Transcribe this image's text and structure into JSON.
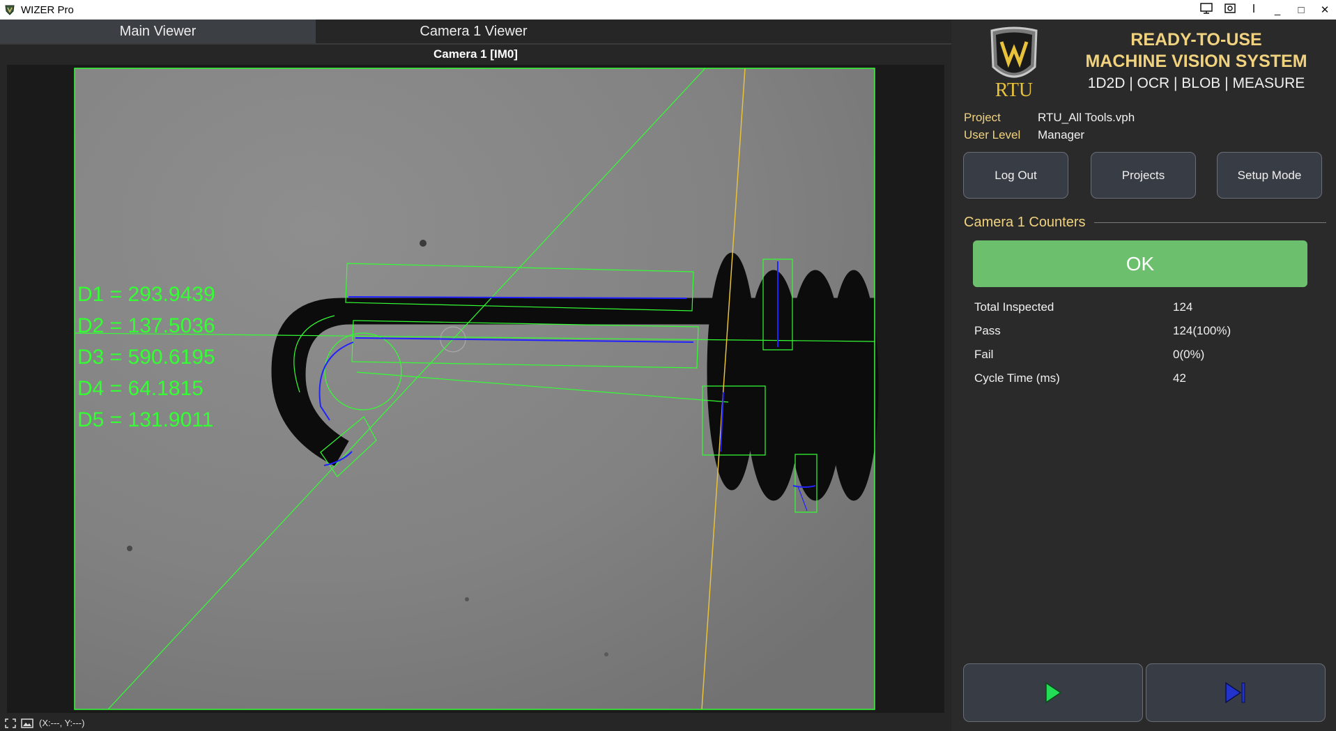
{
  "window": {
    "title": "WIZER Pro",
    "controls": {
      "minimize": "_",
      "maximize": "□",
      "close": "✕"
    }
  },
  "tabs": [
    {
      "label": "Main Viewer",
      "active": true
    },
    {
      "label": "Camera 1 Viewer",
      "active": false
    }
  ],
  "viewer": {
    "title": "Camera 1  [IM0]",
    "measurements": [
      "D1 = 293.9439",
      "D2 = 137.5036",
      "D3 = 590.6195",
      "D4 = 64.1815",
      "D5 = 131.9011"
    ],
    "overlay_colors": {
      "roi": "#33ff33",
      "edge_points": "#2222ff",
      "reference_line": "#e8c23a"
    }
  },
  "statusbar": {
    "coords": "(X:---, Y:---)"
  },
  "branding": {
    "logo_text": "RTU",
    "line1": "READY-TO-USE",
    "line2": "MACHINE VISION SYSTEM",
    "line3": "1D2D | OCR | BLOB | MEASURE"
  },
  "info": {
    "project_label": "Project",
    "project_value": "RTU_All Tools.vph",
    "user_level_label": "User Level",
    "user_level_value": "Manager"
  },
  "buttons": {
    "logout": "Log Out",
    "projects": "Projects",
    "setup_mode": "Setup Mode"
  },
  "counters": {
    "title": "Camera 1 Counters",
    "status": "OK",
    "status_color": "#6cbf6c",
    "rows": [
      {
        "label": "Total Inspected",
        "value": "124"
      },
      {
        "label": "Pass",
        "value": "124(100%)"
      },
      {
        "label": "Fail",
        "value": "0(0%)"
      },
      {
        "label": "Cycle Time (ms)",
        "value": "42"
      }
    ]
  },
  "run_controls": {
    "run_icon": "play-icon",
    "step_icon": "step-forward-icon",
    "run_color": "#22dd55",
    "step_color": "#2233cc"
  },
  "theme": {
    "accent_gold": "#f1d37f",
    "panel_bg": "#2a2a2a"
  }
}
